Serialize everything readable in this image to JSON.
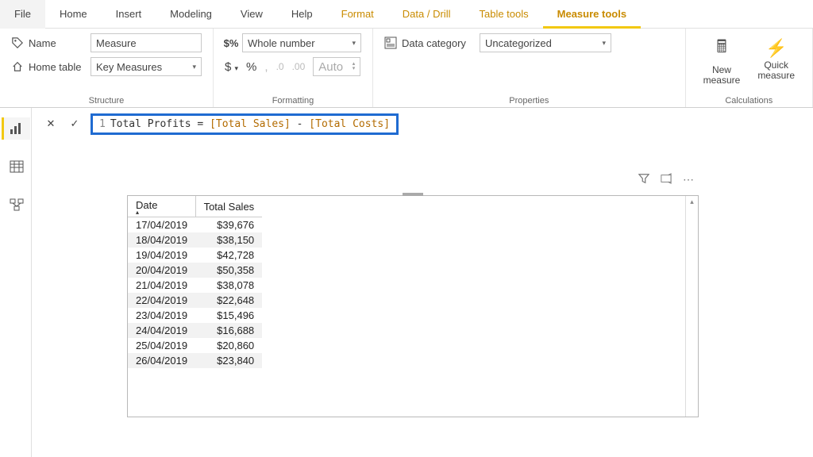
{
  "tabs": {
    "file": "File",
    "home": "Home",
    "insert": "Insert",
    "modeling": "Modeling",
    "view": "View",
    "help": "Help",
    "format": "Format",
    "datadrill": "Data / Drill",
    "tabletools": "Table tools",
    "measuretools": "Measure tools"
  },
  "ribbon": {
    "structure": {
      "group_label": "Structure",
      "name_label": "Name",
      "name_value": "Measure",
      "hometable_label": "Home table",
      "hometable_value": "Key Measures"
    },
    "formatting": {
      "group_label": "Formatting",
      "format_value": "Whole number",
      "dollar": "$",
      "percent": "%",
      "comma": ",",
      "dec0": ".0",
      "dec00": ".00",
      "auto": "Auto"
    },
    "properties": {
      "group_label": "Properties",
      "datacat_label": "Data category",
      "datacat_value": "Uncategorized"
    },
    "calculations": {
      "group_label": "Calculations",
      "new_measure": "New\nmeasure",
      "quick_measure": "Quick\nmeasure"
    }
  },
  "formula": {
    "line_no": "1",
    "prefix": "Total Profits = ",
    "ref1": "[Total Sales]",
    "mid": " - ",
    "ref2": "[Total Costs]"
  },
  "table": {
    "columns": {
      "date": "Date",
      "sales": "Total Sales"
    },
    "rows": [
      {
        "date": "17/04/2019",
        "sales": "$39,676"
      },
      {
        "date": "18/04/2019",
        "sales": "$38,150"
      },
      {
        "date": "19/04/2019",
        "sales": "$42,728"
      },
      {
        "date": "20/04/2019",
        "sales": "$50,358"
      },
      {
        "date": "21/04/2019",
        "sales": "$38,078"
      },
      {
        "date": "22/04/2019",
        "sales": "$22,648"
      },
      {
        "date": "23/04/2019",
        "sales": "$15,496"
      },
      {
        "date": "24/04/2019",
        "sales": "$16,688"
      },
      {
        "date": "25/04/2019",
        "sales": "$20,860"
      },
      {
        "date": "26/04/2019",
        "sales": "$23,840"
      }
    ]
  }
}
